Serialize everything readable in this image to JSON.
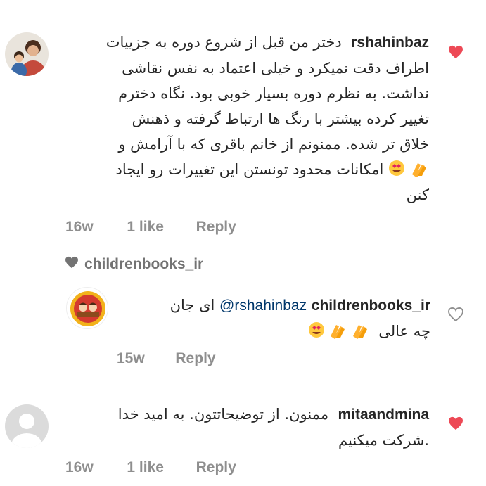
{
  "comments": [
    {
      "username": "rshahinbaz",
      "text_lines": [
        "دختر من قبل از شروع دوره به جزییات",
        "اطراف دقت نمیکرد و خیلی اعتماد به نفس نقاشی",
        "نداشت. به نظرم دوره بسیار خوبی بود. نگاه دخترم",
        "تغییر کرده بیشتر با رنگ ها ارتباط گرفته و ذهنش",
        "خلاق تر شده. ممنونم از خانم باقری که با آرامش و",
        "امکانات محدود تونستن این تغییرات رو ایجاد",
        "کنن"
      ],
      "time": "16w",
      "likes": "1 like",
      "reply": "Reply",
      "liked": true
    },
    {
      "username": "mitaandmina",
      "text_lines": [
        "ممنون. از توضیحاتتون. به امید خدا",
        ".شرکت میکنیم"
      ],
      "time": "16w",
      "likes": "1 like",
      "reply": "Reply",
      "liked": true
    }
  ],
  "replies_indicator": {
    "username": "childrenbooks_ir"
  },
  "reply": {
    "username": "childrenbooks_ir",
    "mention": "@rshahinbaz",
    "text_start": "ای جان",
    "text_end": "چه عالی",
    "time": "15w",
    "reply": "Reply",
    "liked": false
  },
  "colors": {
    "liked_heart": "#ed4956",
    "meta_text": "#8e8e8e",
    "mention": "#00376b"
  }
}
